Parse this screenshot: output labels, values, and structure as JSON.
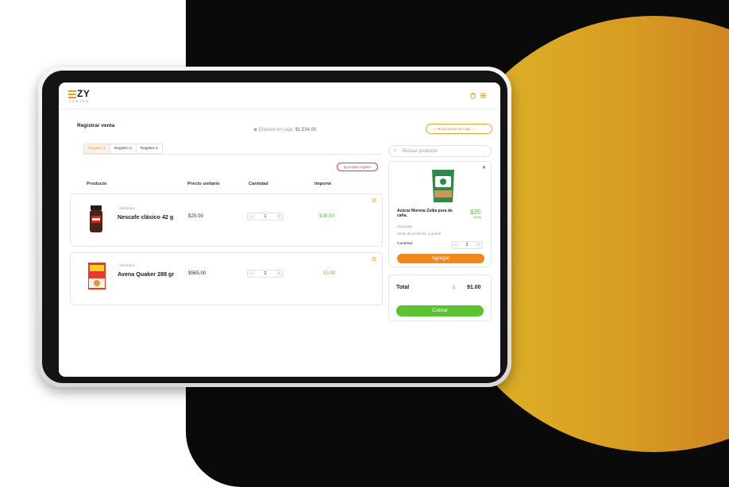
{
  "brand": {
    "name": "ZY",
    "tagline": "VENTAS"
  },
  "header": {
    "bag_icon": "bag-icon",
    "menu_icon": "menu-icon"
  },
  "page": {
    "title": "Registrar venta"
  },
  "cash": {
    "label": "Efectivo en caja:",
    "amount": "$1,534.00"
  },
  "movements_button": {
    "label": "Movimientos de caja"
  },
  "tabs": [
    {
      "label": "Registro 1",
      "active": true
    },
    {
      "label": "Registro 2",
      "active": false
    },
    {
      "label": "Registro 3",
      "active": false
    }
  ],
  "clear_button": {
    "label": "Limpiar registro"
  },
  "table": {
    "columns": [
      "Producto",
      "Precio unitario",
      "Cantidad",
      "Importe"
    ],
    "rows": [
      {
        "category": "Alimentos",
        "name": "Nescafe clásico 42 g",
        "price": "$25.00",
        "qty": "1",
        "total": "$38.00"
      },
      {
        "category": "Alimentos",
        "name": "Avena Quaker 288 gr",
        "price": "$565.00",
        "qty": "2",
        "total": "53.00"
      }
    ]
  },
  "search": {
    "placeholder": "Buscar producto"
  },
  "product_card": {
    "name": "Azúcar Morena Zulka pura de caña.",
    "price": "$35",
    "unit": "$35/kg",
    "category": "Abarrotes",
    "sale_type": "Venta de producto: a granel",
    "qty_label": "Cantidad",
    "qty": "2",
    "add_label": "Agregar"
  },
  "summary": {
    "total_label": "Total",
    "currency": "$",
    "total_value": "91.00",
    "pay_label": "Cobrar"
  },
  "colors": {
    "accent": "#f2881c",
    "success": "#5ac334",
    "danger": "#e23b3b"
  }
}
